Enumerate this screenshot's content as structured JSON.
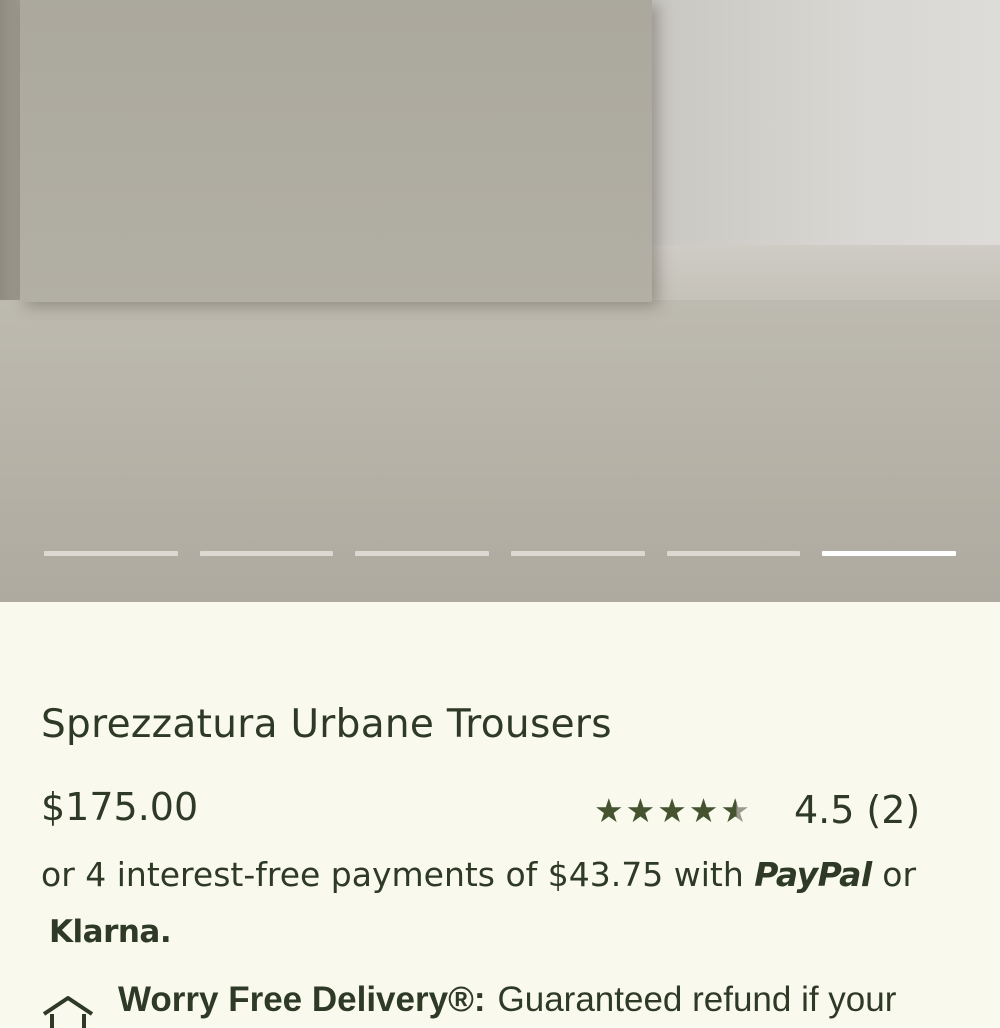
{
  "gallery": {
    "slide_count": 6,
    "active_index": 5
  },
  "product": {
    "title": "Sprezzatura Urbane Trousers",
    "price": "$175.00"
  },
  "rating": {
    "score": 4.5,
    "value_label": "4.5",
    "count_label": "(2)",
    "stars_filled": 4.5,
    "stars_total": 5
  },
  "payment": {
    "prefix": "or 4 interest-free payments of $43.75 with",
    "paypal_label": "PayPal",
    "or_label": "or",
    "klarna_label": "Klarna."
  },
  "delivery": {
    "title": "Worry Free Delivery®:",
    "text": "Guaranteed refund if your"
  },
  "colors": {
    "background": "#f9f9ee",
    "text": "#2e3a26",
    "star": "#45532f"
  }
}
